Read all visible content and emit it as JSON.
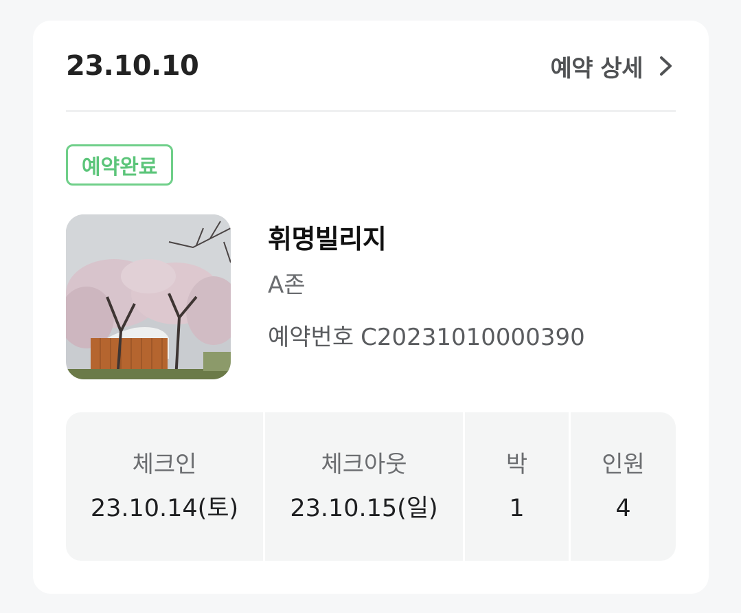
{
  "order": {
    "date": "23.10.10",
    "detail_label": "예약 상세",
    "status": "예약완료"
  },
  "place": {
    "name": "휘명빌리지",
    "zone": "A존",
    "booking_label": "예약번호",
    "booking_number": "C20231010000390"
  },
  "stay": [
    {
      "label": "체크인",
      "value": "23.10.14(토)"
    },
    {
      "label": "체크아웃",
      "value": "23.10.15(일)"
    },
    {
      "label": "박",
      "value": "1"
    },
    {
      "label": "인원",
      "value": "4"
    }
  ],
  "icons": {
    "detail": "chevron-right-icon"
  },
  "colors": {
    "status_green": "#5cc57a",
    "status_border": "#6fcf89",
    "table_bg": "#f4f5f5"
  }
}
